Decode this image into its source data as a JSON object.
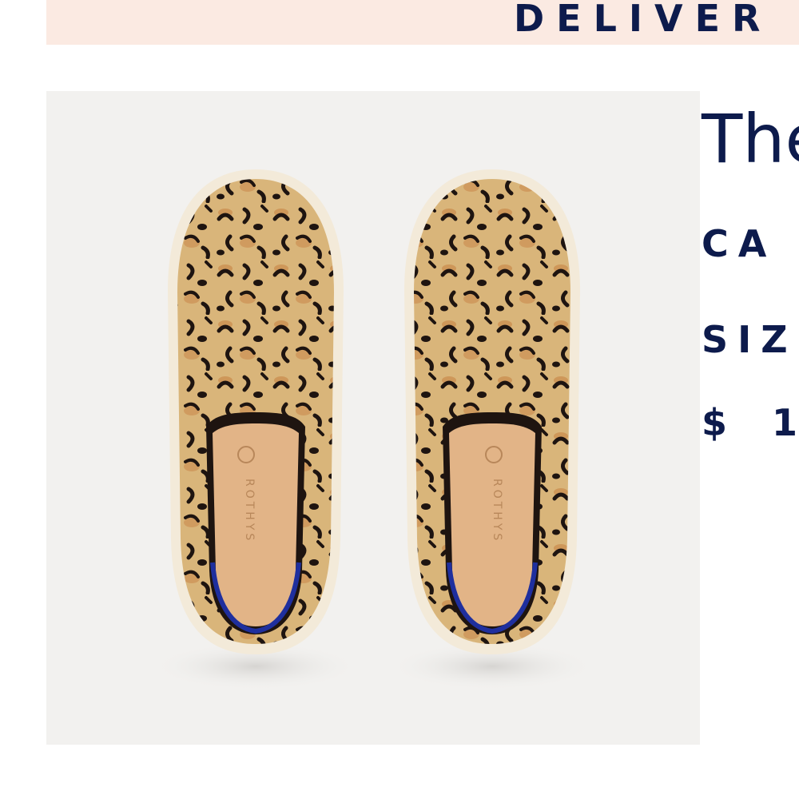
{
  "banner": {
    "text": "DELIVER"
  },
  "product": {
    "image_alt": "Leopard print knit slip-on shoes, top view",
    "insole_brand": "ROTHYS",
    "title": "The",
    "color_label": "CA",
    "size_label": "SIZ",
    "price": "$ 1"
  },
  "colors": {
    "banner_bg": "#fbeae2",
    "text_navy": "#0d1b4c",
    "image_bg": "#f2f1ef",
    "leopard_base": "#d9b57a",
    "insole": "#e2b487",
    "heel_trim": "#1f2f9e"
  }
}
